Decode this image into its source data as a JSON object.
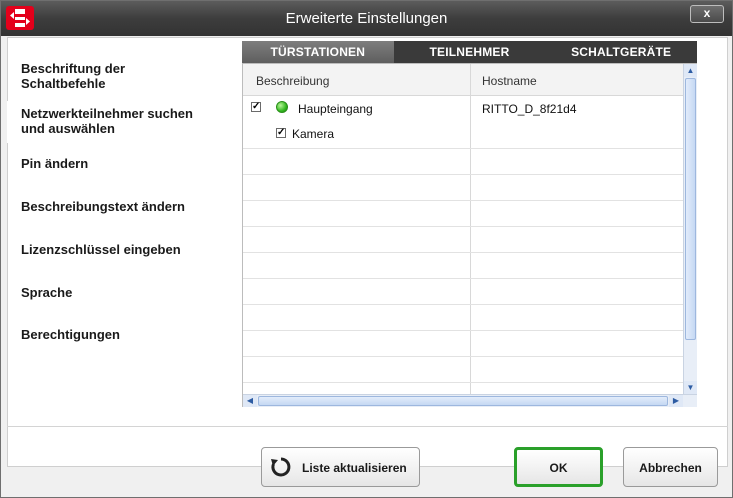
{
  "window": {
    "title": "Erweiterte Einstellungen",
    "close_label": "x",
    "logo_icon": "ritto-logo-icon"
  },
  "sidebar": {
    "items": [
      {
        "label_line1": "Beschriftung der",
        "label_line2": "Schaltbefehle"
      },
      {
        "label_line1": "Netzwerkteilnehmer suchen",
        "label_line2": "und auswählen"
      },
      {
        "label_line1": "Pin ändern",
        "label_line2": ""
      },
      {
        "label_line1": "Beschreibungstext ändern",
        "label_line2": ""
      },
      {
        "label_line1": "Lizenzschlüssel eingeben",
        "label_line2": ""
      },
      {
        "label_line1": "Sprache",
        "label_line2": ""
      },
      {
        "label_line1": "Berechtigungen",
        "label_line2": ""
      }
    ],
    "selected_index": 1
  },
  "tabs": [
    {
      "label": "TÜRSTATIONEN",
      "active": true
    },
    {
      "label": "TEILNEHMER",
      "active": false
    },
    {
      "label": "SCHALTGERÄTE",
      "active": false
    }
  ],
  "table": {
    "columns": [
      "Beschreibung",
      "Hostname"
    ],
    "rows": [
      {
        "checked": true,
        "status": "online",
        "description": "Haupteingang",
        "hostname": "RITTO_D_8f21d4"
      },
      {
        "checked": true,
        "status": "",
        "description": "Kamera",
        "hostname": ""
      }
    ],
    "check_mark": "✓"
  },
  "scrollbars": {
    "up": "▲",
    "down": "▼",
    "left": "◀",
    "right": "▶"
  },
  "buttons": {
    "refresh": "Liste aktualisieren",
    "ok": "OK",
    "cancel": "Abbrechen"
  },
  "colors": {
    "accent_ok_border": "#2aa02a",
    "brand_red": "#e3001b",
    "status_online": "#33b820"
  }
}
